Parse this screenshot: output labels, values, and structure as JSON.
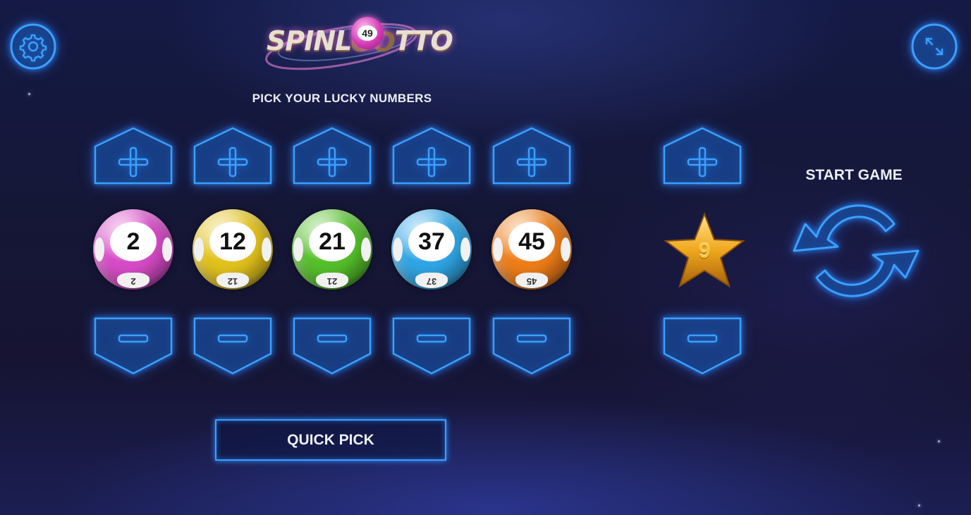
{
  "game": {
    "logo_text_left": "SPINL",
    "logo_text_right": "TTO",
    "logo_ball_number": "49"
  },
  "labels": {
    "pick_title": "PICK YOUR LUCKY NUMBERS",
    "start_game": "START GAME",
    "quick_pick": "QUICK PICK"
  },
  "balls": [
    {
      "number": "2",
      "color": "#d84bc8"
    },
    {
      "number": "12",
      "color": "#e3c21c"
    },
    {
      "number": "21",
      "color": "#55c02a"
    },
    {
      "number": "37",
      "color": "#2fa6e6"
    },
    {
      "number": "45",
      "color": "#ef7d18"
    }
  ],
  "bonus": {
    "number": "9",
    "color": "#f0a81e"
  },
  "icons": {
    "settings": "gear-icon",
    "fullscreen": "expand-icon",
    "increase": "plus-icon",
    "decrease": "minus-icon",
    "start": "refresh-icon",
    "bonus": "star-icon"
  },
  "colors": {
    "neon": "#2c8cff",
    "text": "#eceef6"
  }
}
